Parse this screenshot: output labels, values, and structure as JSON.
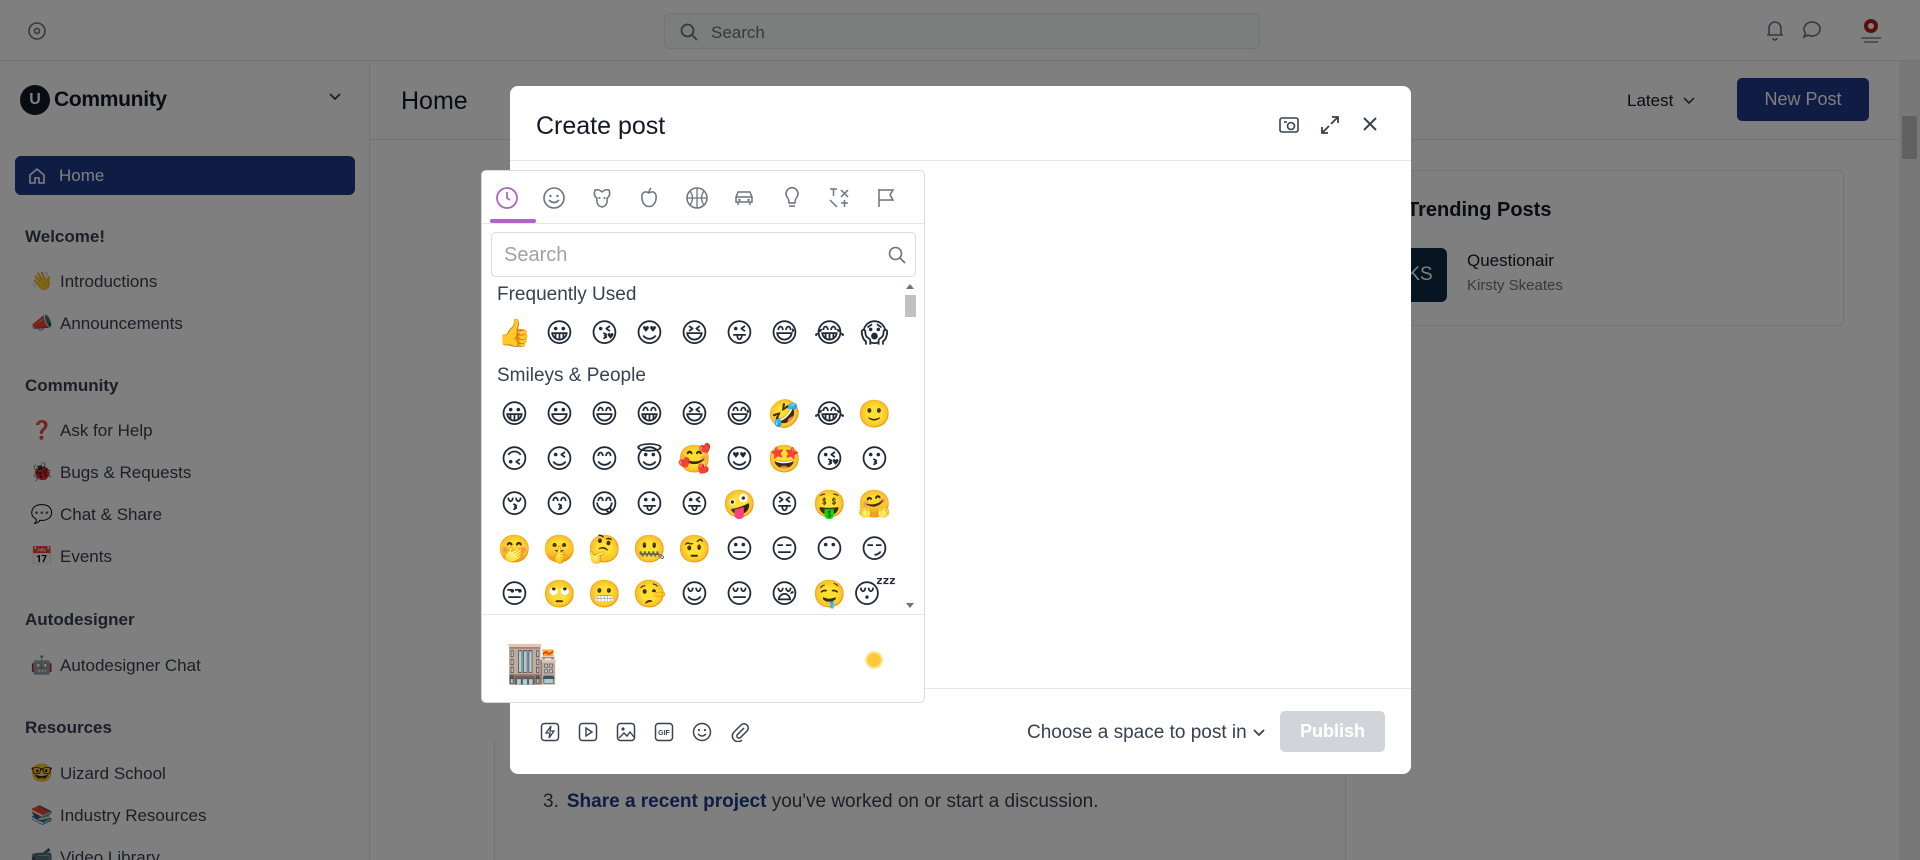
{
  "topbar": {
    "search_placeholder": "Search"
  },
  "sidebar": {
    "brand": "Community",
    "home": "Home",
    "sections": [
      {
        "title": "Welcome!",
        "items": [
          {
            "icon": "👋",
            "label": "Introductions"
          },
          {
            "icon": "📣",
            "label": "Announcements"
          }
        ]
      },
      {
        "title": "Community",
        "items": [
          {
            "icon": "❓",
            "label": "Ask for Help"
          },
          {
            "icon": "🐞",
            "label": "Bugs & Requests"
          },
          {
            "icon": "💬",
            "label": "Chat & Share"
          },
          {
            "icon": "📅",
            "label": "Events"
          }
        ]
      },
      {
        "title": "Autodesigner",
        "items": [
          {
            "icon": "🤖",
            "label": "Autodesigner Chat"
          }
        ]
      },
      {
        "title": "Resources",
        "items": [
          {
            "icon": "🤓",
            "label": "Uizard School"
          },
          {
            "icon": "📚",
            "label": "Industry Resources"
          },
          {
            "icon": "📹",
            "label": "Video Library"
          }
        ]
      }
    ]
  },
  "main": {
    "title": "Home",
    "sort_label": "Latest",
    "new_post": "New Post",
    "trending_title": "Trending Posts",
    "trending_item": {
      "initials": "KS",
      "title": "Questionair",
      "author": "Kirsty Skeates"
    },
    "feed_line": {
      "num": "3.",
      "link": "Share a recent project",
      "rest": " you've worked on or start a discussion."
    }
  },
  "modal": {
    "title": "Create post",
    "space_select": "Choose a space to post in",
    "publish": "Publish"
  },
  "picker": {
    "search_placeholder": "Search",
    "frequently_used_label": "Frequently Used",
    "frequently_used": [
      "👍",
      "😀",
      "😘",
      "😍",
      "😆",
      "😜",
      "😅",
      "😂",
      "😱"
    ],
    "smileys_label": "Smileys & People",
    "smileys_rows": [
      [
        "😀",
        "😃",
        "😄",
        "😁",
        "😆",
        "😅",
        "🤣",
        "😂",
        "🙂"
      ],
      [
        "🙃",
        "😉",
        "😊",
        "😇",
        "🥰",
        "😍",
        "🤩",
        "😘",
        "😗"
      ],
      [
        "😚",
        "😙",
        "😋",
        "😛",
        "😜",
        "🤪",
        "😝",
        "🤑",
        "🤗"
      ],
      [
        "🤭",
        "🤫",
        "🤔",
        "🤐",
        "🤨",
        "😐",
        "😑",
        "😶",
        "😏"
      ],
      [
        "😒",
        "🙄",
        "😬",
        "🤥",
        "😌",
        "😔",
        "😪",
        "🤤",
        "😴"
      ]
    ],
    "preview_emoji": "🏬",
    "skin_tone_color": "#ffc93a",
    "accent_color": "#ae65c5"
  }
}
